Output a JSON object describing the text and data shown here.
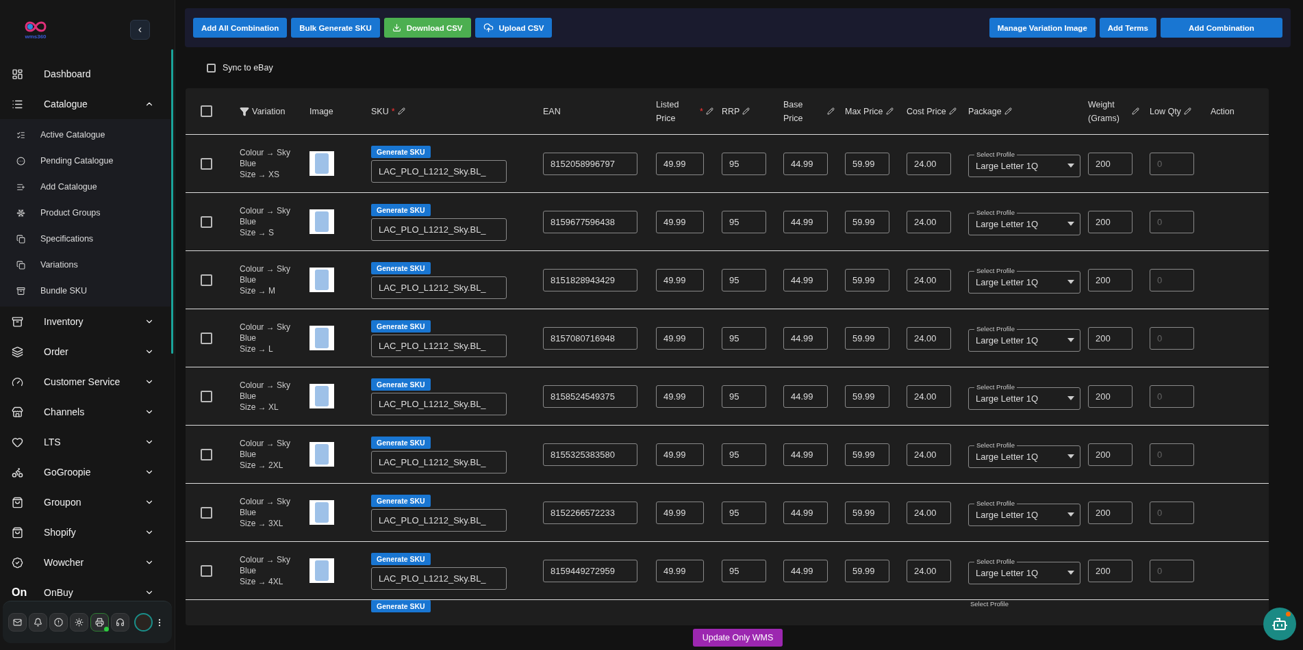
{
  "sidebar": {
    "logo_text": "wms360",
    "collapse_button": "‹",
    "items": [
      {
        "label": "Dashboard",
        "kind": "link"
      },
      {
        "label": "Catalogue",
        "kind": "group",
        "expanded": true,
        "children": [
          {
            "label": "Active Catalogue"
          },
          {
            "label": "Pending Catalogue"
          },
          {
            "label": "Add Catalogue"
          },
          {
            "label": "Product Groups"
          },
          {
            "label": "Specifications"
          },
          {
            "label": "Variations"
          },
          {
            "label": "Bundle SKU"
          }
        ]
      },
      {
        "label": "Inventory",
        "kind": "group",
        "expanded": false
      },
      {
        "label": "Order",
        "kind": "group",
        "expanded": false
      },
      {
        "label": "Customer Service",
        "kind": "group",
        "expanded": false
      },
      {
        "label": "Channels",
        "kind": "group",
        "expanded": false
      },
      {
        "label": "LTS",
        "kind": "group",
        "expanded": false
      },
      {
        "label": "GoGroopie",
        "kind": "group",
        "expanded": false
      },
      {
        "label": "Groupon",
        "kind": "group",
        "expanded": false
      },
      {
        "label": "Shopify",
        "kind": "group",
        "expanded": false
      },
      {
        "label": "Wowcher",
        "kind": "group",
        "expanded": false
      },
      {
        "label": "OnBuy",
        "kind": "group",
        "expanded": false,
        "mark": "On"
      }
    ]
  },
  "toolbar": {
    "left": [
      {
        "label": "Add All Combination",
        "kind": "plain"
      },
      {
        "label": "Bulk Generate SKU",
        "kind": "plain"
      },
      {
        "label": "Download CSV",
        "kind": "download"
      },
      {
        "label": "Upload CSV",
        "kind": "upload"
      }
    ],
    "right": [
      {
        "label": "Manage Variation Image",
        "kind": "plain"
      },
      {
        "label": "Add Terms",
        "kind": "plain"
      },
      {
        "label": "Add Combination",
        "kind": "wide"
      }
    ]
  },
  "sync": {
    "label": "Sync to eBay",
    "checked": false
  },
  "table": {
    "select_all": {
      "checked": false
    },
    "required_mark": "*",
    "columns": [
      {
        "label": "Variation",
        "filter": true,
        "required": false,
        "editable": false
      },
      {
        "label": "Image",
        "required": false,
        "editable": false
      },
      {
        "label": "SKU",
        "required": true,
        "editable": true
      },
      {
        "label": "EAN",
        "required": false,
        "editable": false
      },
      {
        "label": "Listed Price",
        "required": true,
        "editable": true
      },
      {
        "label": "RRP",
        "required": false,
        "editable": true
      },
      {
        "label": "Base Price",
        "required": false,
        "editable": true
      },
      {
        "label": "Max Price",
        "required": false,
        "editable": true
      },
      {
        "label": "Cost Price",
        "required": false,
        "editable": true
      },
      {
        "label": "Package",
        "required": false,
        "editable": true
      },
      {
        "label": "Weight (Grams)",
        "required": false,
        "editable": true
      },
      {
        "label": "Low Qty",
        "required": false,
        "editable": true
      },
      {
        "label": "Action",
        "required": false,
        "editable": false
      }
    ],
    "rows": [
      {
        "checked": false,
        "variation": [
          "Colour → Sky Blue",
          "Size → XS"
        ],
        "generate": "Generate SKU",
        "sku": "LAC_PLO_L1212_Sky.BL_",
        "ean": "8152058996797",
        "listed": "49.99",
        "rrp": "95",
        "base": "44.99",
        "max": "59.99",
        "cost": "24.00",
        "package_label": "Select Profile",
        "package": "Large Letter 1Q",
        "weight": "200",
        "low_qty_placeholder": "0"
      },
      {
        "checked": false,
        "variation": [
          "Colour → Sky Blue",
          "Size → S"
        ],
        "generate": "Generate SKU",
        "sku": "LAC_PLO_L1212_Sky.BL_",
        "ean": "8159677596438",
        "listed": "49.99",
        "rrp": "95",
        "base": "44.99",
        "max": "59.99",
        "cost": "24.00",
        "package_label": "Select Profile",
        "package": "Large Letter 1Q",
        "weight": "200",
        "low_qty_placeholder": "0"
      },
      {
        "checked": false,
        "variation": [
          "Colour → Sky Blue",
          "Size → M"
        ],
        "generate": "Generate SKU",
        "sku": "LAC_PLO_L1212_Sky.BL_",
        "ean": "8151828943429",
        "listed": "49.99",
        "rrp": "95",
        "base": "44.99",
        "max": "59.99",
        "cost": "24.00",
        "package_label": "Select Profile",
        "package": "Large Letter 1Q",
        "weight": "200",
        "low_qty_placeholder": "0"
      },
      {
        "checked": false,
        "variation": [
          "Colour → Sky Blue",
          "Size → L"
        ],
        "generate": "Generate SKU",
        "sku": "LAC_PLO_L1212_Sky.BL_",
        "ean": "8157080716948",
        "listed": "49.99",
        "rrp": "95",
        "base": "44.99",
        "max": "59.99",
        "cost": "24.00",
        "package_label": "Select Profile",
        "package": "Large Letter 1Q",
        "weight": "200",
        "low_qty_placeholder": "0"
      },
      {
        "checked": false,
        "variation": [
          "Colour → Sky Blue",
          "Size → XL"
        ],
        "generate": "Generate SKU",
        "sku": "LAC_PLO_L1212_Sky.BL_",
        "ean": "8158524549375",
        "listed": "49.99",
        "rrp": "95",
        "base": "44.99",
        "max": "59.99",
        "cost": "24.00",
        "package_label": "Select Profile",
        "package": "Large Letter 1Q",
        "weight": "200",
        "low_qty_placeholder": "0"
      },
      {
        "checked": false,
        "variation": [
          "Colour → Sky Blue",
          "Size → 2XL"
        ],
        "generate": "Generate SKU",
        "sku": "LAC_PLO_L1212_Sky.BL_",
        "ean": "8155325383580",
        "listed": "49.99",
        "rrp": "95",
        "base": "44.99",
        "max": "59.99",
        "cost": "24.00",
        "package_label": "Select Profile",
        "package": "Large Letter 1Q",
        "weight": "200",
        "low_qty_placeholder": "0"
      },
      {
        "checked": false,
        "variation": [
          "Colour → Sky Blue",
          "Size → 3XL"
        ],
        "generate": "Generate SKU",
        "sku": "LAC_PLO_L1212_Sky.BL_",
        "ean": "8152266572233",
        "listed": "49.99",
        "rrp": "95",
        "base": "44.99",
        "max": "59.99",
        "cost": "24.00",
        "package_label": "Select Profile",
        "package": "Large Letter 1Q",
        "weight": "200",
        "low_qty_placeholder": "0"
      },
      {
        "checked": false,
        "variation": [
          "Colour → Sky Blue",
          "Size → 4XL"
        ],
        "generate": "Generate SKU",
        "sku": "LAC_PLO_L1212_Sky.BL_",
        "ean": "8159449272959",
        "listed": "49.99",
        "rrp": "95",
        "base": "44.99",
        "max": "59.99",
        "cost": "24.00",
        "package_label": "Select Profile",
        "package": "Large Letter 1Q",
        "weight": "200",
        "low_qty_placeholder": "0"
      }
    ],
    "partial_row": {
      "generate": "Generate SKU",
      "package_label": "Select Profile"
    }
  },
  "footer": {
    "button": "Update Only WMS"
  }
}
